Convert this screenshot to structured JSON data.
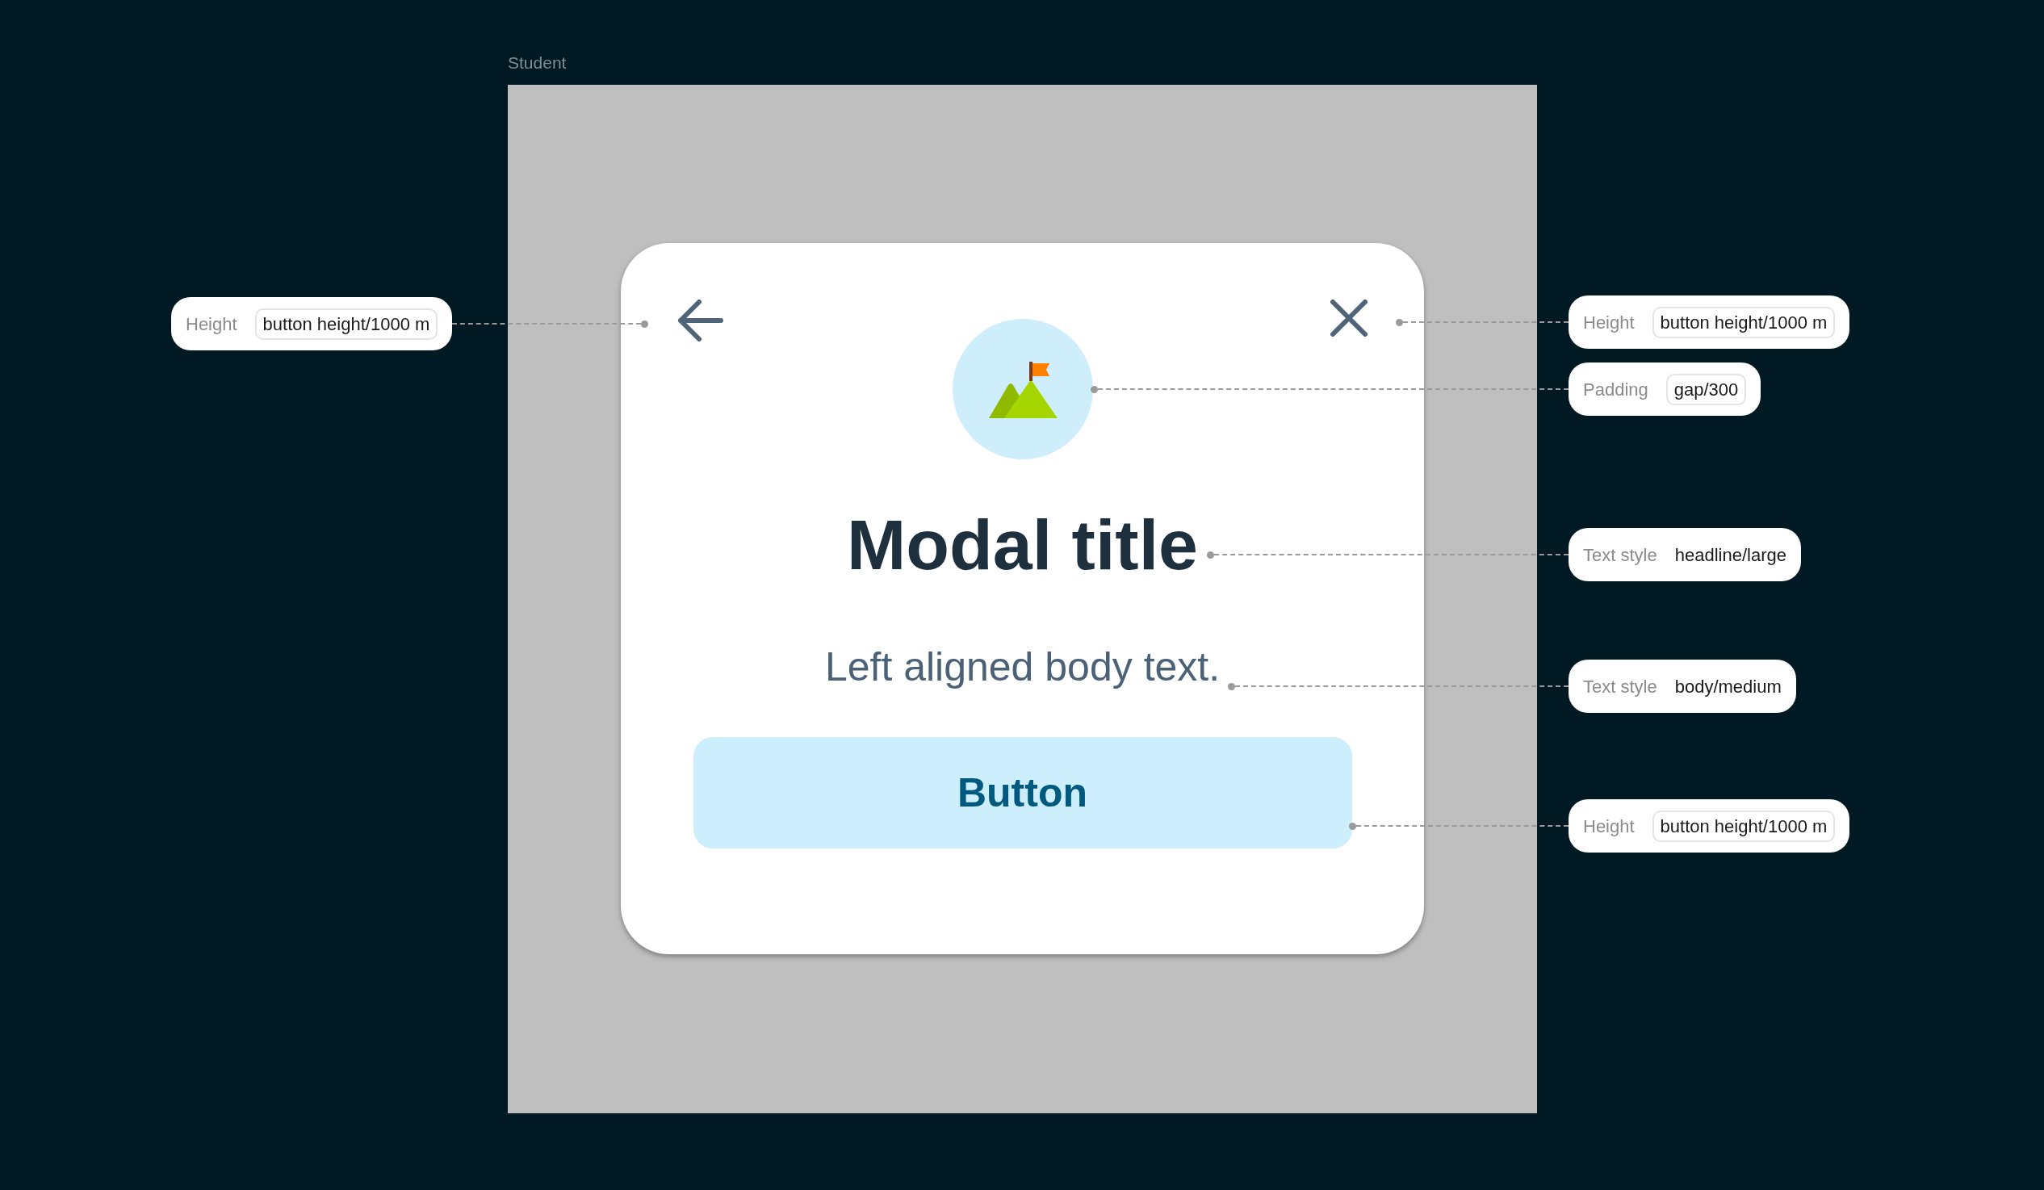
{
  "frame": {
    "label": "Student"
  },
  "modal": {
    "title": "Modal title",
    "body": "Left aligned body text.",
    "button": "Button"
  },
  "annotations": [
    {
      "label": "Height",
      "value": "button height/1000 m",
      "kind": "token"
    },
    {
      "label": "Height",
      "value": "button height/1000 m",
      "kind": "token"
    },
    {
      "label": "Padding",
      "value": "gap/300",
      "kind": "token"
    },
    {
      "label": "Text style",
      "value": "headline/large",
      "kind": "style"
    },
    {
      "label": "Text style",
      "value": "body/medium",
      "kind": "style"
    },
    {
      "label": "Height",
      "value": "button height/1000 m",
      "kind": "token"
    }
  ]
}
